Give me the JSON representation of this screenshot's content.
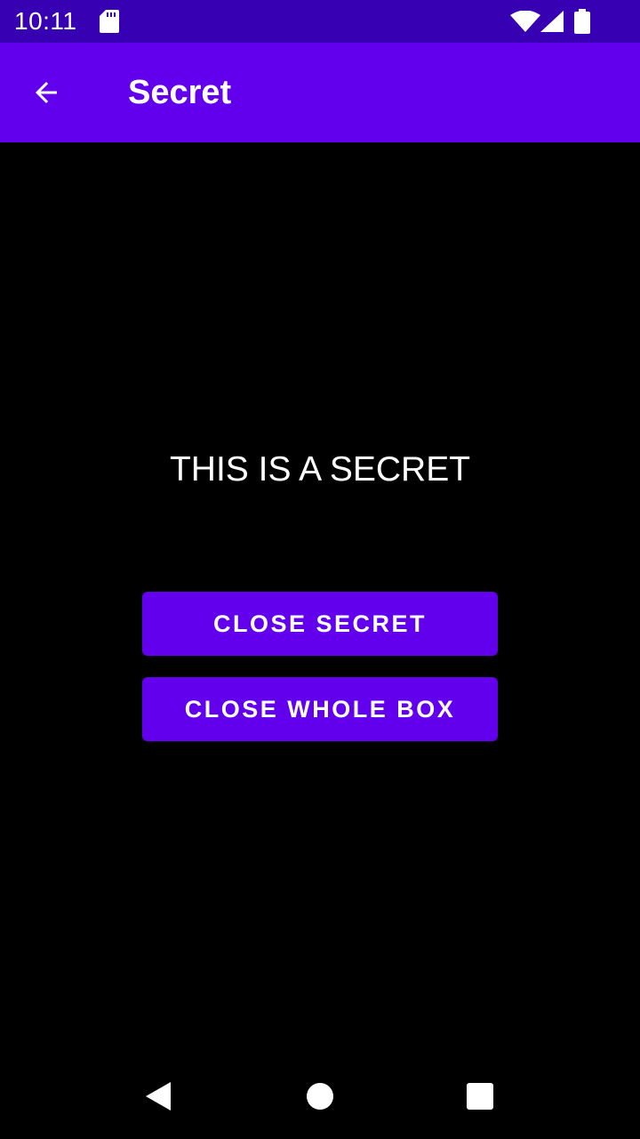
{
  "status_bar": {
    "time": "10:11",
    "icons": [
      "sd-card-icon",
      "wifi-icon",
      "cell-signal-icon",
      "battery-icon"
    ]
  },
  "app_bar": {
    "title": "Secret",
    "back_icon": "arrow-back-icon"
  },
  "content": {
    "secret_text": "THIS IS A SECRET",
    "close_secret_label": "CLOSE SECRET",
    "close_whole_box_label": "CLOSE WHOLE BOX"
  },
  "nav_bar": {
    "icons": [
      "nav-back-icon",
      "nav-home-icon",
      "nav-recents-icon"
    ]
  },
  "colors": {
    "status_bar": "#3700B3",
    "primary": "#6200EE",
    "background": "#000000",
    "text": "#FFFFFF"
  }
}
